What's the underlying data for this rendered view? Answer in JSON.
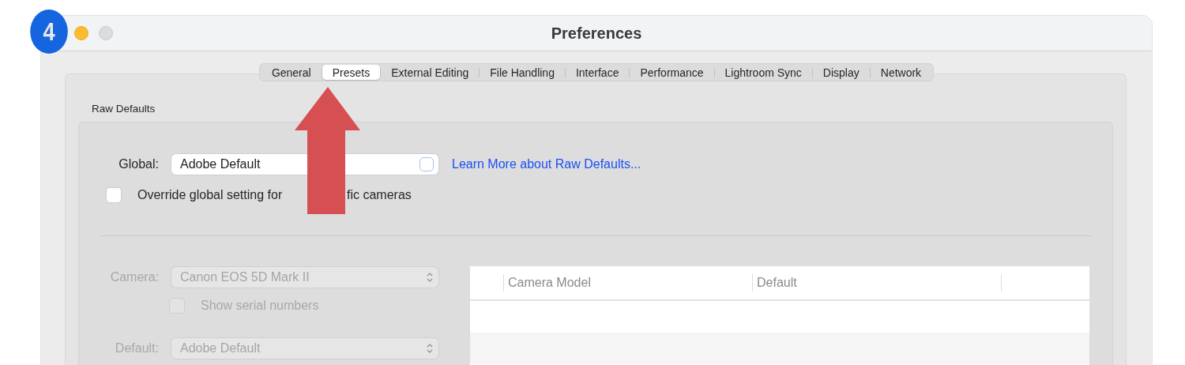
{
  "badge": "4",
  "window": {
    "title": "Preferences"
  },
  "tabs": [
    {
      "label": "General",
      "selected": false
    },
    {
      "label": "Presets",
      "selected": true
    },
    {
      "label": "External Editing",
      "selected": false
    },
    {
      "label": "File Handling",
      "selected": false
    },
    {
      "label": "Interface",
      "selected": false
    },
    {
      "label": "Performance",
      "selected": false
    },
    {
      "label": "Lightroom Sync",
      "selected": false
    },
    {
      "label": "Display",
      "selected": false
    },
    {
      "label": "Network",
      "selected": false
    }
  ],
  "section": {
    "title": "Raw Defaults"
  },
  "global": {
    "label": "Global:",
    "value": "Adobe Default",
    "disabled": false
  },
  "learn_more_link": "Learn More about Raw Defaults...",
  "override": {
    "label_parts": [
      "Override global setting for",
      "fic cameras"
    ],
    "checked": false,
    "disabled": false
  },
  "camera": {
    "label": "Camera:",
    "value": "Canon EOS 5D Mark II",
    "disabled": true
  },
  "show_serial": {
    "label": "Show serial numbers",
    "checked": false,
    "disabled": true
  },
  "default": {
    "label": "Default:",
    "value": "Adobe Default",
    "disabled": true
  },
  "table": {
    "columns": [
      "Camera Model",
      "Default"
    ]
  }
}
